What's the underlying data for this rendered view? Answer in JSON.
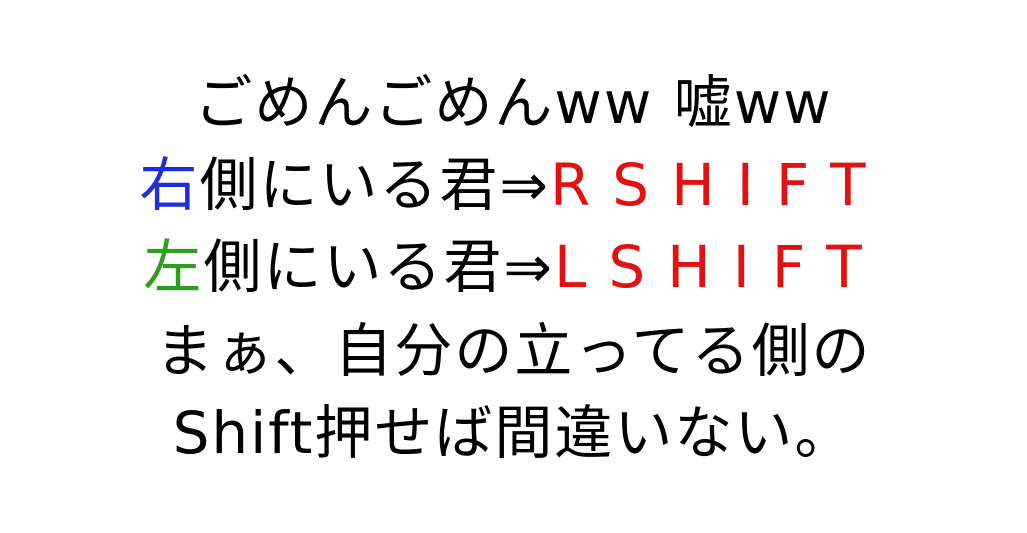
{
  "lines": {
    "line1": {
      "text": "ごめんごめんww 嘘ww"
    },
    "line2": {
      "kanji": "右",
      "rest": "側にいる君⇒",
      "key": "RSHIFT"
    },
    "line3": {
      "kanji": "左",
      "rest": "側にいる君⇒",
      "key": "LSHIFT"
    },
    "line4": {
      "text": "まぁ、自分の立ってる側の"
    },
    "line5": {
      "text": "Shift押せば間違いない。"
    }
  },
  "colors": {
    "text": "#000000",
    "right": "#1f2fd6",
    "left": "#2e9e1e",
    "key": "#e31212",
    "background": "#ffffff"
  }
}
